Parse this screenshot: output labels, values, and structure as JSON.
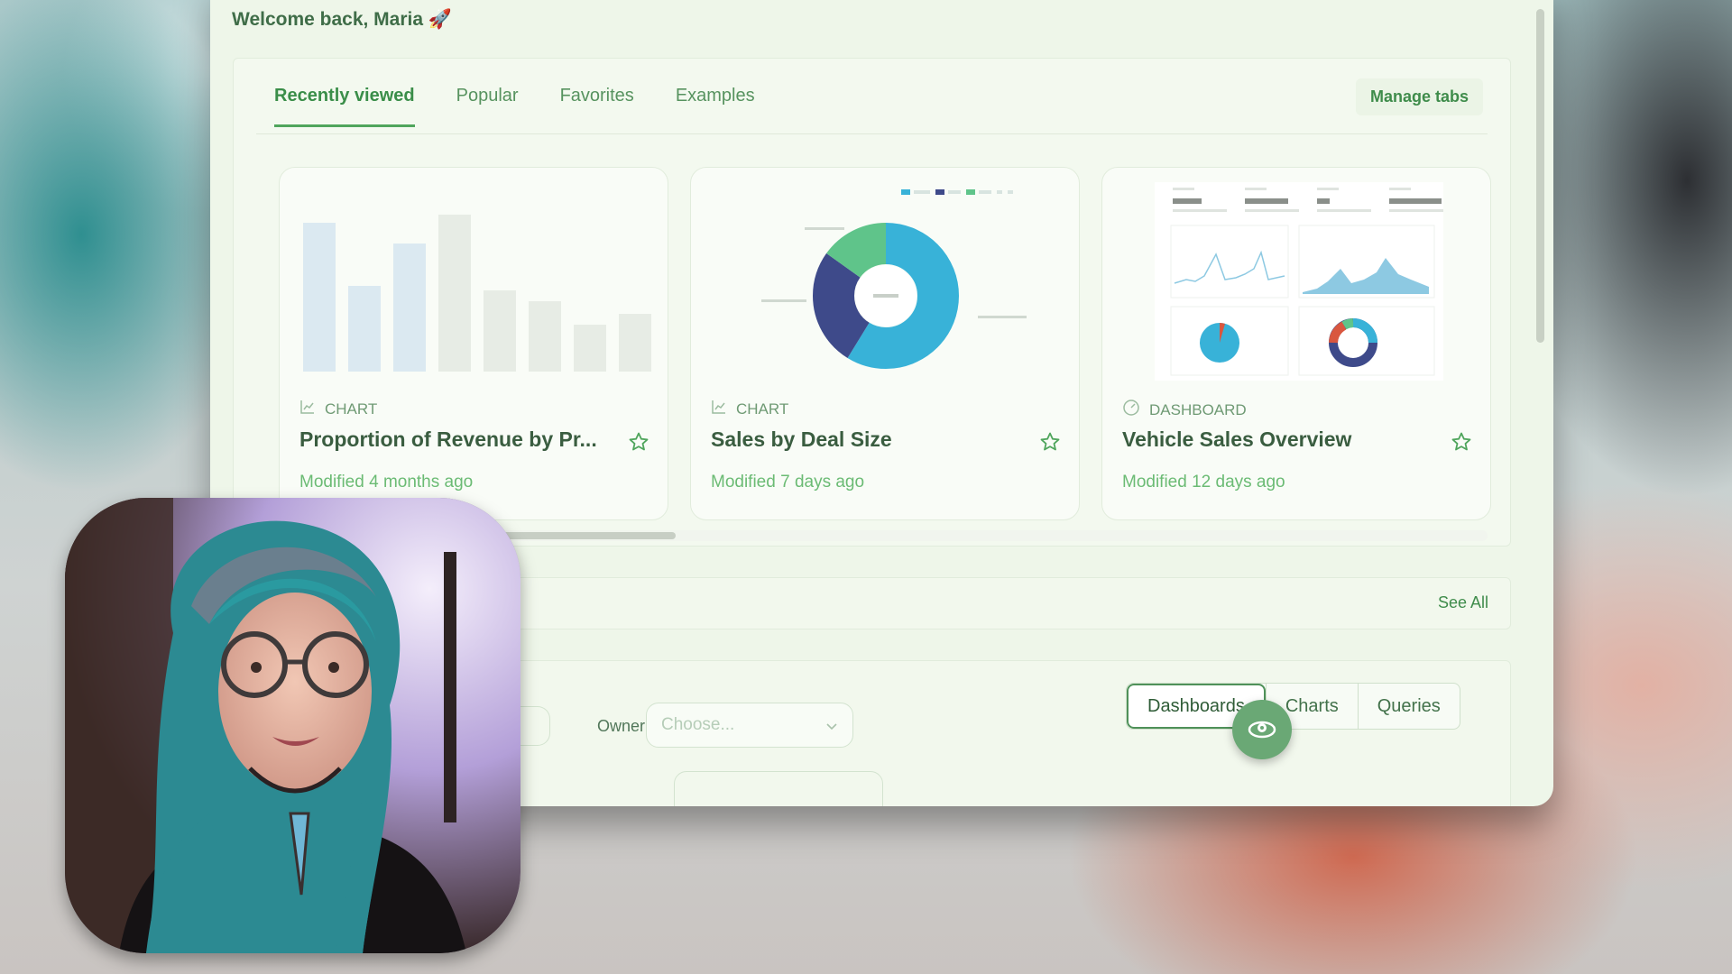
{
  "header": {
    "welcome": "Welcome back, Maria 🚀"
  },
  "tabs": [
    {
      "label": "Recently viewed",
      "active": true
    },
    {
      "label": "Popular",
      "active": false
    },
    {
      "label": "Favorites",
      "active": false
    },
    {
      "label": "Examples",
      "active": false
    }
  ],
  "manage_tabs_label": "Manage tabs",
  "cards": [
    {
      "type": "CHART",
      "title": "Proportion of Revenue by Pr...",
      "modified": "Modified 4 months ago",
      "icon": "line-chart-icon",
      "thumbnail": "bar-chart"
    },
    {
      "type": "CHART",
      "title": "Sales by Deal Size",
      "modified": "Modified 7 days ago",
      "icon": "line-chart-icon",
      "thumbnail": "donut-chart"
    },
    {
      "type": "DASHBOARD",
      "title": "Vehicle Sales Overview",
      "modified": "Modified 12 days ago",
      "icon": "dashboard-icon",
      "thumbnail": "dashboard"
    }
  ],
  "section2": {
    "see_all_label": "See All"
  },
  "filters": {
    "owner_label": "Owner",
    "owner_placeholder": "Choose..."
  },
  "segmented": [
    {
      "label": "Dashboards",
      "active": true
    },
    {
      "label": "Charts",
      "active": false
    },
    {
      "label": "Queries",
      "active": false
    }
  ],
  "colors": {
    "accent": "#4fa55c",
    "window_bg": "#eef6e9",
    "donut": [
      "#38b2d8",
      "#3e4a8a",
      "#5fc48a"
    ]
  }
}
